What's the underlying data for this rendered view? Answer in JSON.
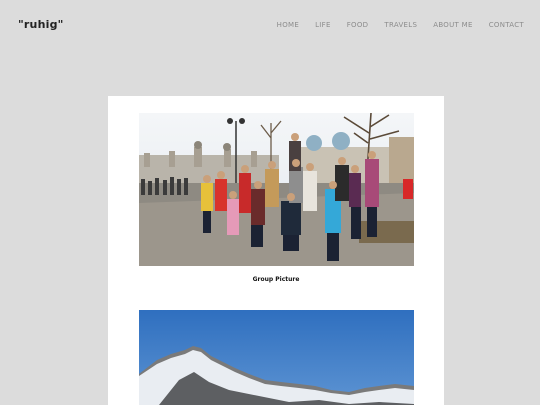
{
  "site": {
    "logo": "\"ruhig\""
  },
  "nav": {
    "items": [
      "HOME",
      "LIFE",
      "FOOD",
      "TRAVELS",
      "ABOUT ME",
      "CONTACT"
    ]
  },
  "gallery": {
    "photos": [
      {
        "caption": "Group Picture"
      },
      {
        "caption": ""
      }
    ]
  }
}
